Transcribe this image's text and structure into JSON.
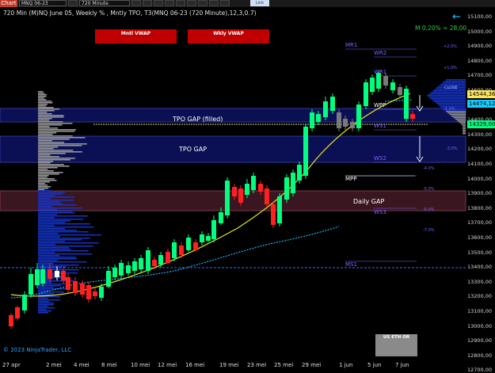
{
  "toolbar": {
    "chart_label": "Chart",
    "instrument": "MNQ 06-23",
    "interval": "720 Minute",
    "extra": "",
    "link_button": "Link"
  },
  "title": "720 Min (M)NQ June 05, Weekly % , Mntly TPO, T3(MNQ 06-23 (720 Minute),12,3,0.7)",
  "indicator_value": "M 0,20% = 28,00",
  "copyright": "© 2023 NinjaTrader, LLC",
  "buttons": {
    "mntly_vwap": "Mntl VWAP",
    "wkly_vwap": "Wkly VWAP",
    "us_eth_or": "US ETH OR"
  },
  "gaps": {
    "tpo_gap_filled": "TPO GAP (filled)",
    "tpo_gap": "TPO GAP",
    "daily_gap": "Daily GAP"
  },
  "levels": {
    "mr1": "MR1",
    "wr2": "WR2",
    "wr1": "WR1",
    "wpp": "WPP",
    "ws1": "WS1",
    "ws2": "WS2",
    "mpp": "MPP",
    "ws3": "WS3",
    "ms1": "MS1",
    "close": "CLOSE"
  },
  "pct_labels": [
    "+2.0%",
    "+1.0%",
    "-1.0%",
    "-3.0%",
    "-4.0%",
    "-5.0%",
    "-6.0%",
    "-7.0%"
  ],
  "price_axis": [
    "15100,00",
    "15000,00",
    "14900,00",
    "14800,00",
    "14700,00",
    "14600,00",
    "14500,00",
    "14400,00",
    "14300,00",
    "14200,00",
    "14100,00",
    "14000,00",
    "13900,00",
    "13800,00",
    "13700,00",
    "13600,00",
    "13500,00",
    "13400,00",
    "13300,00",
    "13200,00",
    "13100,00",
    "13000,00",
    "12900,00",
    "12800,00",
    "12700,00"
  ],
  "price_tags": {
    "last": "14544,36",
    "level1": "14474,12",
    "current": "14329,00"
  },
  "x_axis_dates": [
    "27 apr",
    "2 mei",
    "4 mei",
    "8 mei",
    "10 mei",
    "12 mei",
    "16 mei",
    "19 mei",
    "23 mei",
    "25 mei",
    "29 mei",
    "1 jun",
    "5 jun",
    "7 jun"
  ],
  "colors": {
    "bull": "#00ff7f",
    "bear": "#ff2020",
    "vwap_line": "#e6e61a",
    "wkly_vwap_line": "#19c9ff",
    "tpo_gap_fill": "#0b1055",
    "daily_gap_fill": "#3a1620"
  }
}
